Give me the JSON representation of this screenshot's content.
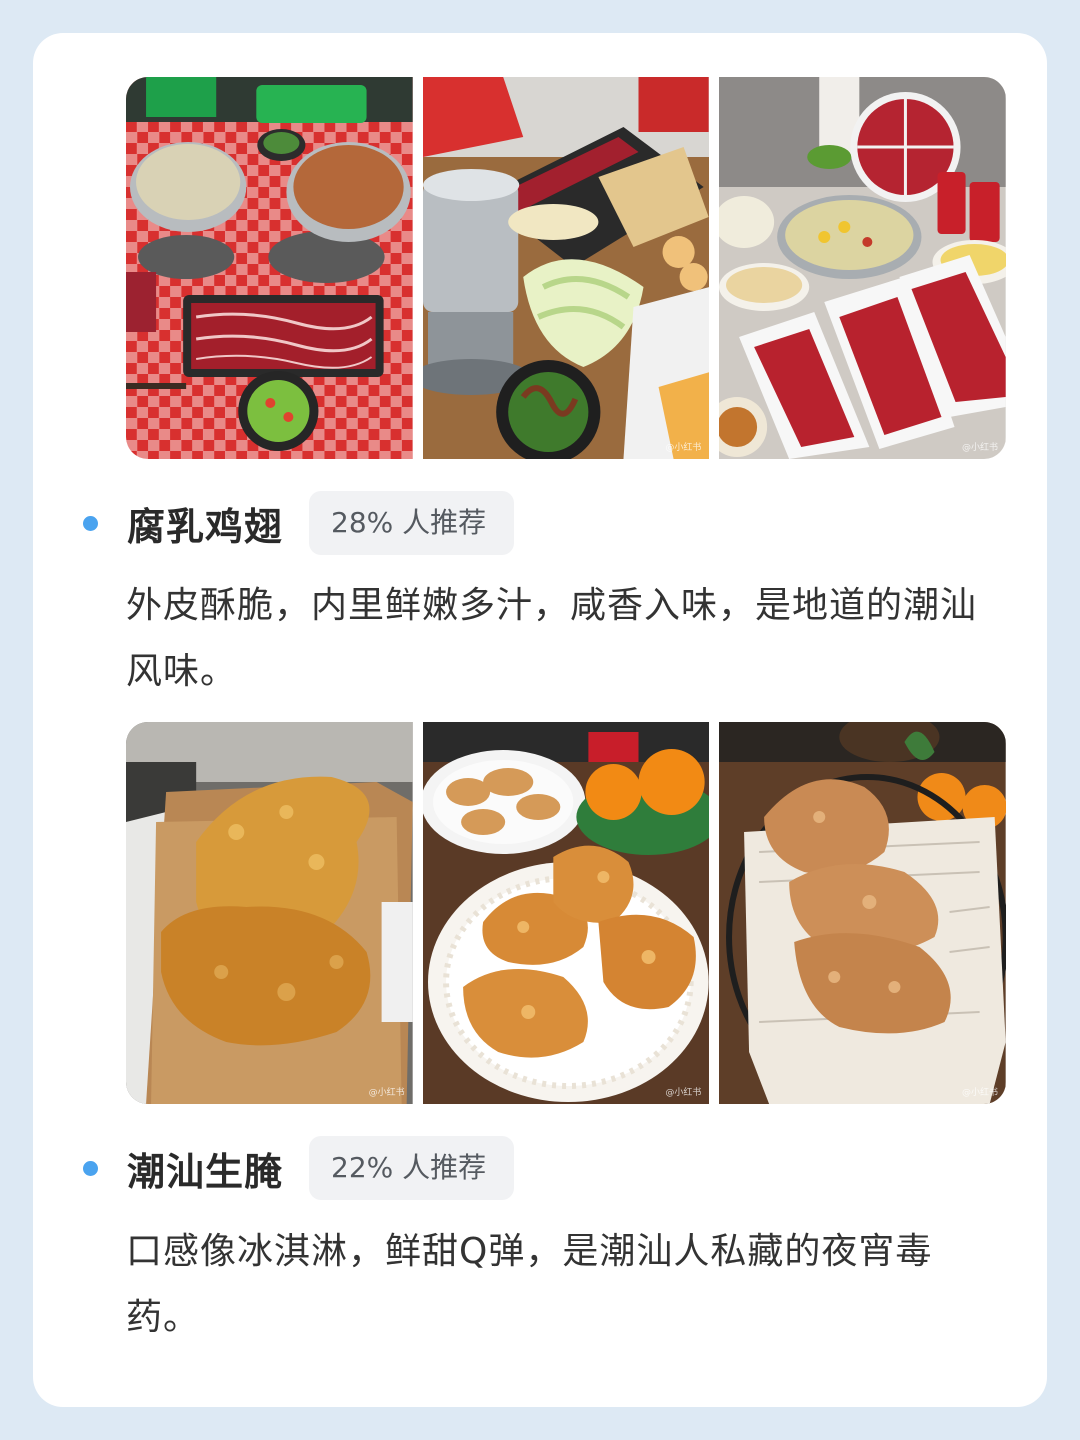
{
  "top_gallery": {
    "photos": [
      {
        "subject": "hotpot-table-red-checkered",
        "watermark": ""
      },
      {
        "subject": "hotpot-beef-noodles-cabbage",
        "watermark": "@小红书"
      },
      {
        "subject": "hotpot-beef-platters",
        "watermark": "@小红书"
      }
    ]
  },
  "items": [
    {
      "title": "腐乳鸡翅",
      "badge": "28% 人推荐",
      "description": "外皮酥脆，内里鲜嫩多汁，咸香入味，是地道的潮汕风味。"
    },
    {
      "title": "潮汕生腌",
      "badge": "22% 人推荐",
      "description": "口感像冰淇淋，鲜甜Q弹，是潮汕人私藏的夜宵毒药。"
    }
  ],
  "bottom_gallery": {
    "photos": [
      {
        "subject": "fried-wings-paper-box",
        "watermark": "@小红书"
      },
      {
        "subject": "fried-wings-doily-plate",
        "watermark": "@小红书"
      },
      {
        "subject": "fried-wings-wire-basket",
        "watermark": "@小红书"
      }
    ]
  },
  "colors": {
    "background": "#dde9f4",
    "card": "#ffffff",
    "bullet": "#4aa3ef",
    "badge_bg": "#f1f2f4",
    "title_text": "#2a2a2a",
    "body_text": "#333333"
  }
}
